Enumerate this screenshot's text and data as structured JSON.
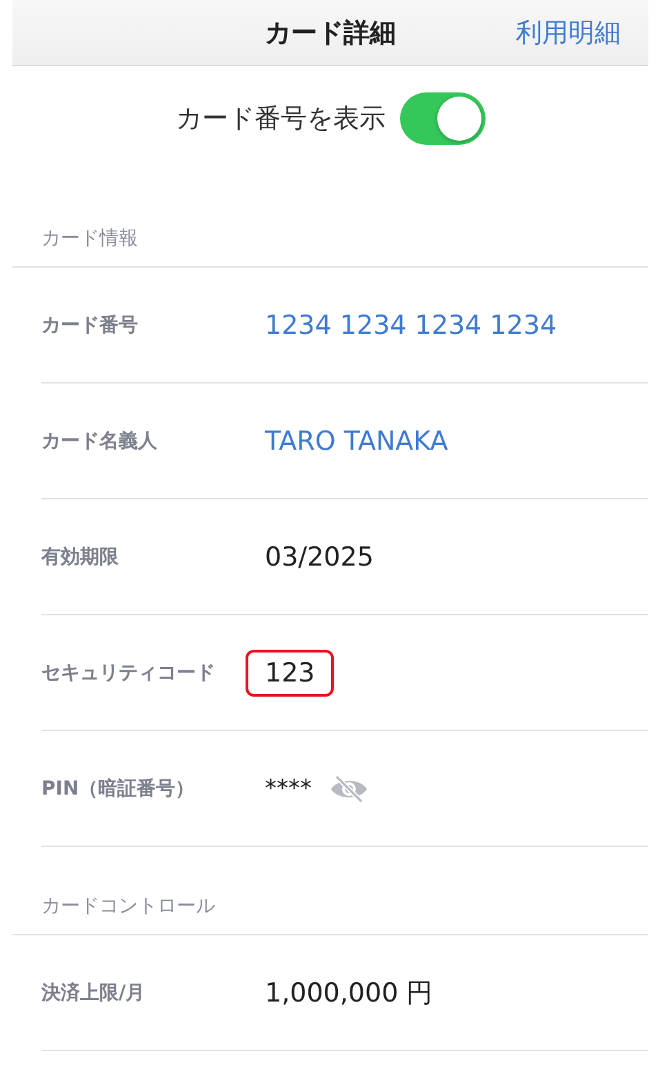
{
  "nav": {
    "title": "カード詳細",
    "action": "利用明細"
  },
  "toggle": {
    "label": "カード番号を表示",
    "on": true
  },
  "sections": [
    {
      "title": "カード情報",
      "rows": [
        {
          "label": "カード番号",
          "value": "1234 1234 1234 1234",
          "kind": "accent"
        },
        {
          "label": "カード名義人",
          "value": "TARO TANAKA",
          "kind": "accent"
        },
        {
          "label": "有効期限",
          "value": "03/2025",
          "kind": "plain"
        },
        {
          "label": "セキュリティコード",
          "value": "123",
          "kind": "boxed"
        },
        {
          "label": "PIN（暗証番号）",
          "value": "****",
          "kind": "secret"
        }
      ]
    },
    {
      "title": "カードコントロール",
      "rows": [
        {
          "label": "決済上限/月",
          "value": "1,000,000 円",
          "kind": "plain"
        }
      ]
    }
  ]
}
